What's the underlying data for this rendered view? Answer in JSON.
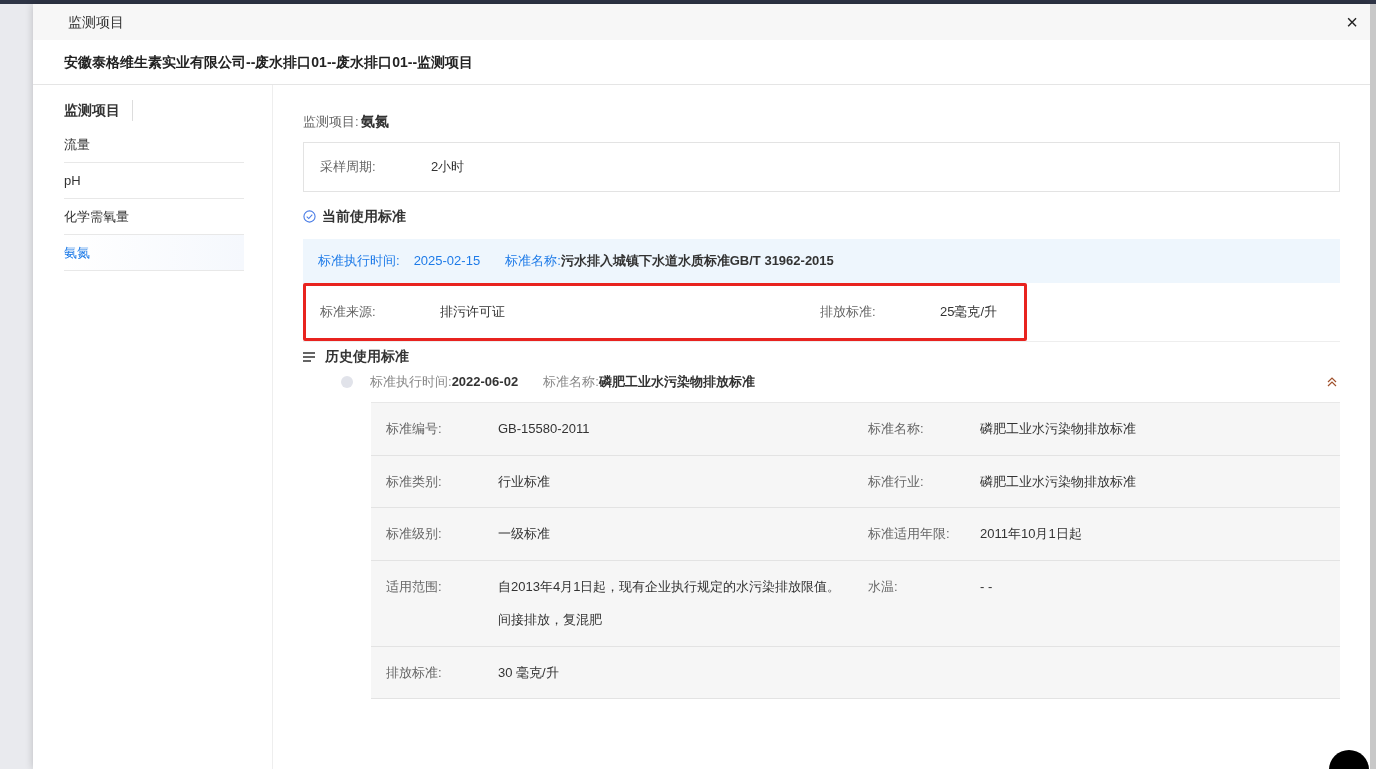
{
  "dialog": {
    "title": "监测项目",
    "close": "×"
  },
  "subtitle": "安徽泰格维生素实业有限公司--废水排口01--废水排口01--监测项目",
  "sidebar": {
    "title": "监测项目",
    "items": [
      {
        "label": "流量",
        "selected": false
      },
      {
        "label": "pH",
        "selected": false
      },
      {
        "label": "化学需氧量",
        "selected": false
      },
      {
        "label": "氨氮",
        "selected": true
      }
    ]
  },
  "item": {
    "label": "监测项目:",
    "value": "氨氮"
  },
  "sampling": {
    "label": "采样周期:",
    "value": "2小时"
  },
  "current": {
    "title": "当前使用标准",
    "date_label": "标准执行时间:",
    "date": "2025-02-15",
    "name_label": "标准名称:",
    "name": "污水排入城镇下水道水质标准GB/T 31962-2015",
    "fields": [
      {
        "label": "标准来源:",
        "value": "排污许可证"
      },
      {
        "label": "排放标准:",
        "value": "25毫克/升"
      }
    ],
    "highlighted": true
  },
  "history": {
    "title": "历史使用标准",
    "entries": [
      {
        "date_label": "标准执行时间:",
        "date": "2022-06-02",
        "name_label": "标准名称:",
        "name": "磷肥工业水污染物排放标准",
        "expanded": true,
        "rows": [
          [
            {
              "label": "标准编号:",
              "value": [
                "GB-15580-2011"
              ]
            },
            {
              "label": "标准名称:",
              "value": [
                "磷肥工业水污染物排放标准"
              ]
            }
          ],
          [
            {
              "label": "标准类别:",
              "value": [
                "行业标准"
              ]
            },
            {
              "label": "标准行业:",
              "value": [
                "磷肥工业水污染物排放标准"
              ]
            }
          ],
          [
            {
              "label": "标准级别:",
              "value": [
                "一级标准"
              ]
            },
            {
              "label": "标准适用年限:",
              "value": [
                "2011年10月1日起"
              ]
            }
          ],
          [
            {
              "label": "适用范围:",
              "value": [
                "自2013年4月1日起，现有企业执行规定的水污染排放限值。",
                "间接排放，复混肥"
              ]
            },
            {
              "label": "水温:",
              "value": [
                "- -"
              ]
            }
          ],
          [
            {
              "label": "排放标准:",
              "value": [
                "30 毫克/升"
              ]
            }
          ]
        ]
      }
    ]
  }
}
